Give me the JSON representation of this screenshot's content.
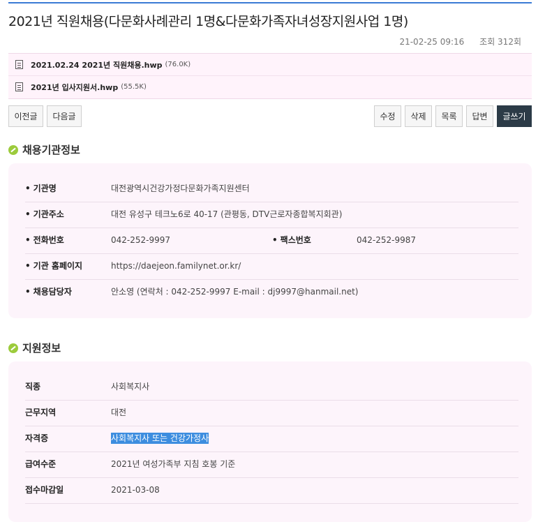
{
  "post": {
    "title": "2021년 직원채용(다문화사례관리 1명&다문화가족자녀성장지원사업 1명)",
    "date": "21-02-25 09:16",
    "views": "조회 312회"
  },
  "attachments": [
    {
      "name": "2021.02.24 2021년 직원채용.hwp",
      "size": "(76.0K)"
    },
    {
      "name": "2021년 입사지원서.hwp",
      "size": "(55.5K)"
    }
  ],
  "nav": {
    "prev": "이전글",
    "next": "다음글"
  },
  "actions": {
    "edit": "수정",
    "delete": "삭제",
    "list": "목록",
    "reply": "답변",
    "write": "글쓰기"
  },
  "org_section": {
    "heading": "채용기관정보",
    "rows": [
      {
        "label": "기관명",
        "value": "대전광역시건강가정다문화가족지원센터"
      },
      {
        "label": "기관주소",
        "value": "대전 유성구 테크노6로 40-17 (관평동, DTV근로자종합복지회관)"
      },
      {
        "label": "전화번호",
        "value": "042-252-9997",
        "label2": "팩스번호",
        "value2": "042-252-9987"
      },
      {
        "label": "기관 홈페이지",
        "value": "https://daejeon.familynet.or.kr/"
      },
      {
        "label": "채용담당자",
        "value": "안소영 (연락처 : 042-252-9997 E-mail : dj9997@hanmail.net)"
      }
    ]
  },
  "apply_section": {
    "heading": "지원정보",
    "rows": [
      {
        "label": "직종",
        "value": "사회복지사"
      },
      {
        "label": "근무지역",
        "value": "대전"
      },
      {
        "label": "자격증",
        "value": "사회복지사 또는 건강가정사"
      },
      {
        "label": "급여수준",
        "value": "2021년 여성가족부 지침 호봉 기준"
      },
      {
        "label": "접수마감일",
        "value": "2021-03-08"
      }
    ]
  },
  "colors": {
    "accent_line": "#3a7bd5",
    "card_bg": "#fdf4fb",
    "dark_button": "#2c3b47",
    "leaf": "#9ccb3c",
    "selection": "#3d8ddf"
  }
}
